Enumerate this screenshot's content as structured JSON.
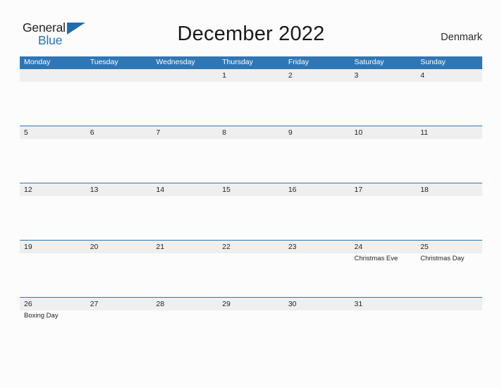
{
  "logo": {
    "word_one": "General",
    "word_two": "Blue",
    "icon": "flag-triangle-icon",
    "color_dark": "#231f20",
    "color_blue": "#2272b9"
  },
  "header": {
    "title": "December 2022",
    "country": "Denmark"
  },
  "theme": {
    "header_blue": "#2f76b5",
    "band_gray": "#efefef",
    "page_background": "#fcfcfd",
    "text": "#231f20"
  },
  "calendar": {
    "weekdays": [
      "Monday",
      "Tuesday",
      "Wednesday",
      "Thursday",
      "Friday",
      "Saturday",
      "Sunday"
    ],
    "weeks": [
      [
        {
          "day": "",
          "event": ""
        },
        {
          "day": "",
          "event": ""
        },
        {
          "day": "",
          "event": ""
        },
        {
          "day": "1",
          "event": ""
        },
        {
          "day": "2",
          "event": ""
        },
        {
          "day": "3",
          "event": ""
        },
        {
          "day": "4",
          "event": ""
        }
      ],
      [
        {
          "day": "5",
          "event": ""
        },
        {
          "day": "6",
          "event": ""
        },
        {
          "day": "7",
          "event": ""
        },
        {
          "day": "8",
          "event": ""
        },
        {
          "day": "9",
          "event": ""
        },
        {
          "day": "10",
          "event": ""
        },
        {
          "day": "11",
          "event": ""
        }
      ],
      [
        {
          "day": "12",
          "event": ""
        },
        {
          "day": "13",
          "event": ""
        },
        {
          "day": "14",
          "event": ""
        },
        {
          "day": "15",
          "event": ""
        },
        {
          "day": "16",
          "event": ""
        },
        {
          "day": "17",
          "event": ""
        },
        {
          "day": "18",
          "event": ""
        }
      ],
      [
        {
          "day": "19",
          "event": ""
        },
        {
          "day": "20",
          "event": ""
        },
        {
          "day": "21",
          "event": ""
        },
        {
          "day": "22",
          "event": ""
        },
        {
          "day": "23",
          "event": ""
        },
        {
          "day": "24",
          "event": "Christmas Eve"
        },
        {
          "day": "25",
          "event": "Christmas Day"
        }
      ],
      [
        {
          "day": "26",
          "event": "Boxing Day"
        },
        {
          "day": "27",
          "event": ""
        },
        {
          "day": "28",
          "event": ""
        },
        {
          "day": "29",
          "event": ""
        },
        {
          "day": "30",
          "event": ""
        },
        {
          "day": "31",
          "event": ""
        },
        {
          "day": "",
          "event": ""
        }
      ]
    ]
  }
}
